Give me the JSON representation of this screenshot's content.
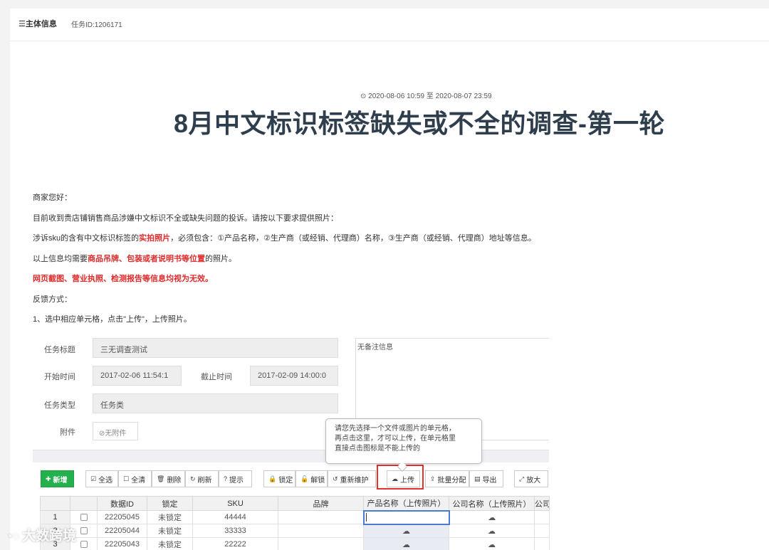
{
  "header": {
    "title": "☰主体信息",
    "task_id": "任务ID:1206171"
  },
  "date_range": "⊙ 2020-08-06 10:59 至 2020-08-07 23:59",
  "page_title": "8月中文标识标签缺失或不全的调查-第一轮",
  "body": {
    "greeting": "商家您好：",
    "line1": "目前收到贵店铺销售商品涉嫌中文标识不全或缺失问题的投诉。请按以下要求提供照片：",
    "line2_a": "涉诉sku的含有中文标识标签的",
    "line2_red": "实拍照片",
    "line2_b": "，必须包含：①产品名称，②生产商（或经销、代理商）名称，③生产商（或经销、代理商）地址等信息。",
    "line3_a": "以上信息均需要",
    "line3_red": "商品吊牌、包装或者说明书等位置",
    "line3_b": "的照片。",
    "line4_red": "网页截图、营业执照、检测报告等信息均视为无效。",
    "feedback": "反馈方式：",
    "step1": "1、选中相应单元格，点击\"上传\"，上传照片。"
  },
  "form": {
    "title_label": "任务标题",
    "title_value": "三无调查测试",
    "start_label": "开始时间",
    "start_value": "2017-02-06 11:54:1",
    "end_label": "截止时间",
    "end_value": "2017-02-09 14:00:0",
    "type_label": "任务类型",
    "type_value": "任务类",
    "attach_label": "附件",
    "attach_value": "⊘无附件",
    "note": "无备注信息"
  },
  "tooltip": {
    "line1": "请您先选择一个文件或图片的单元格，",
    "line2": "再点击这里，才可以上传，在单元格里",
    "line3": "直接点击图标是不能上传的"
  },
  "toolbar": {
    "add": "新增",
    "select_all": "全选",
    "clear_all": "全清",
    "delete": "删除",
    "refresh": "刷新",
    "hint": "提示",
    "lock": "锁定",
    "unlock": "解锁",
    "remaintain": "重新维护",
    "upload": "上传",
    "batch_assign": "批量分配",
    "export": "导出",
    "zoom": "放大"
  },
  "grid": {
    "columns": [
      "",
      "",
      "数据ID",
      "锁定",
      "SKU",
      "品牌",
      "产品名称（上传照片）",
      "公司名称（上传照片）",
      "公司"
    ],
    "rows": [
      {
        "num": "1",
        "id": "22205045",
        "lock": "未锁定",
        "sku": "44444"
      },
      {
        "num": "2",
        "id": "22205044",
        "lock": "未锁定",
        "sku": "33333"
      },
      {
        "num": "3",
        "id": "22205043",
        "lock": "未锁定",
        "sku": "22222"
      }
    ]
  },
  "watermark": "大数跨境",
  "colors": {
    "accent_red": "#e02b2b",
    "add_green": "#23b14d",
    "title_dark": "#2f3e4d"
  }
}
